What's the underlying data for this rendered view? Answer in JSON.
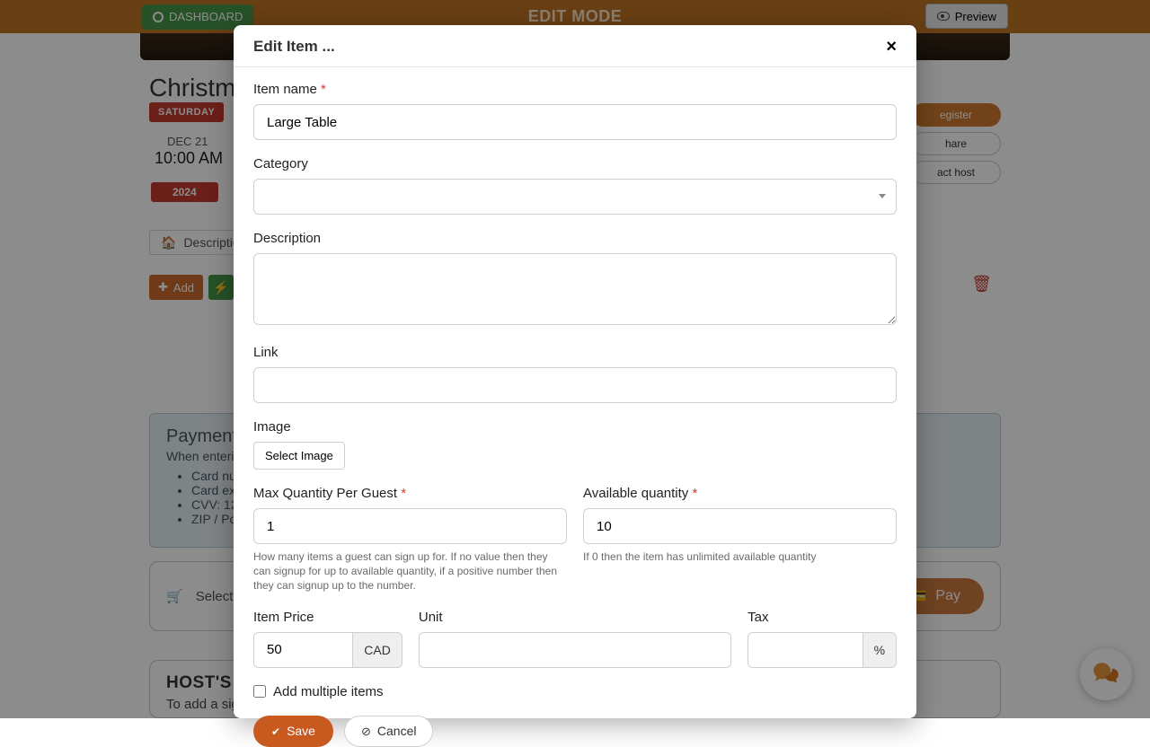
{
  "topbar": {
    "dashboard": "DASHBOARD",
    "mode": "EDIT MODE",
    "preview": "Preview"
  },
  "event": {
    "title_visible": "Christmas",
    "day": "SATURDAY",
    "date": "DEC 21",
    "time": "10:00 AM",
    "year": "2024"
  },
  "right_buttons": {
    "register": "egister",
    "share": "hare",
    "contact": "act host"
  },
  "tabs": {
    "description_visible": "Descriptio"
  },
  "toolbar": {
    "add": "Add"
  },
  "payments_panel": {
    "heading": "Payments",
    "intro": "When enteri",
    "items": [
      "Card nu",
      "Card ex",
      "CVV: 12",
      "ZIP / Pc"
    ]
  },
  "cart": {
    "selected": "Selecte",
    "pay": "Pay"
  },
  "host_note": {
    "heading": "HOST'S N",
    "text": "To add a sig"
  },
  "modal": {
    "title": "Edit Item ...",
    "labels": {
      "item_name": "Item name",
      "category": "Category",
      "description": "Description",
      "link": "Link",
      "image": "Image",
      "select_image": "Select Image",
      "max_qty": "Max Quantity Per Guest",
      "avail_qty": "Available quantity",
      "item_price": "Item Price",
      "unit": "Unit",
      "tax": "Tax",
      "add_multiple": "Add multiple items",
      "save": "Save",
      "cancel": "Cancel"
    },
    "values": {
      "item_name": "Large Table",
      "category": "",
      "description": "",
      "link": "",
      "max_qty": "1",
      "avail_qty": "10",
      "item_price": "50",
      "unit": "",
      "tax": ""
    },
    "help": {
      "max_qty": "How many items a guest can sign up for. If no value then they can signup for up to available quantity, if a positive number then they can signup up to the number.",
      "avail_qty": "If 0 then the item has unlimited available quantity"
    },
    "suffix": {
      "price": "CAD",
      "tax": "%"
    }
  }
}
